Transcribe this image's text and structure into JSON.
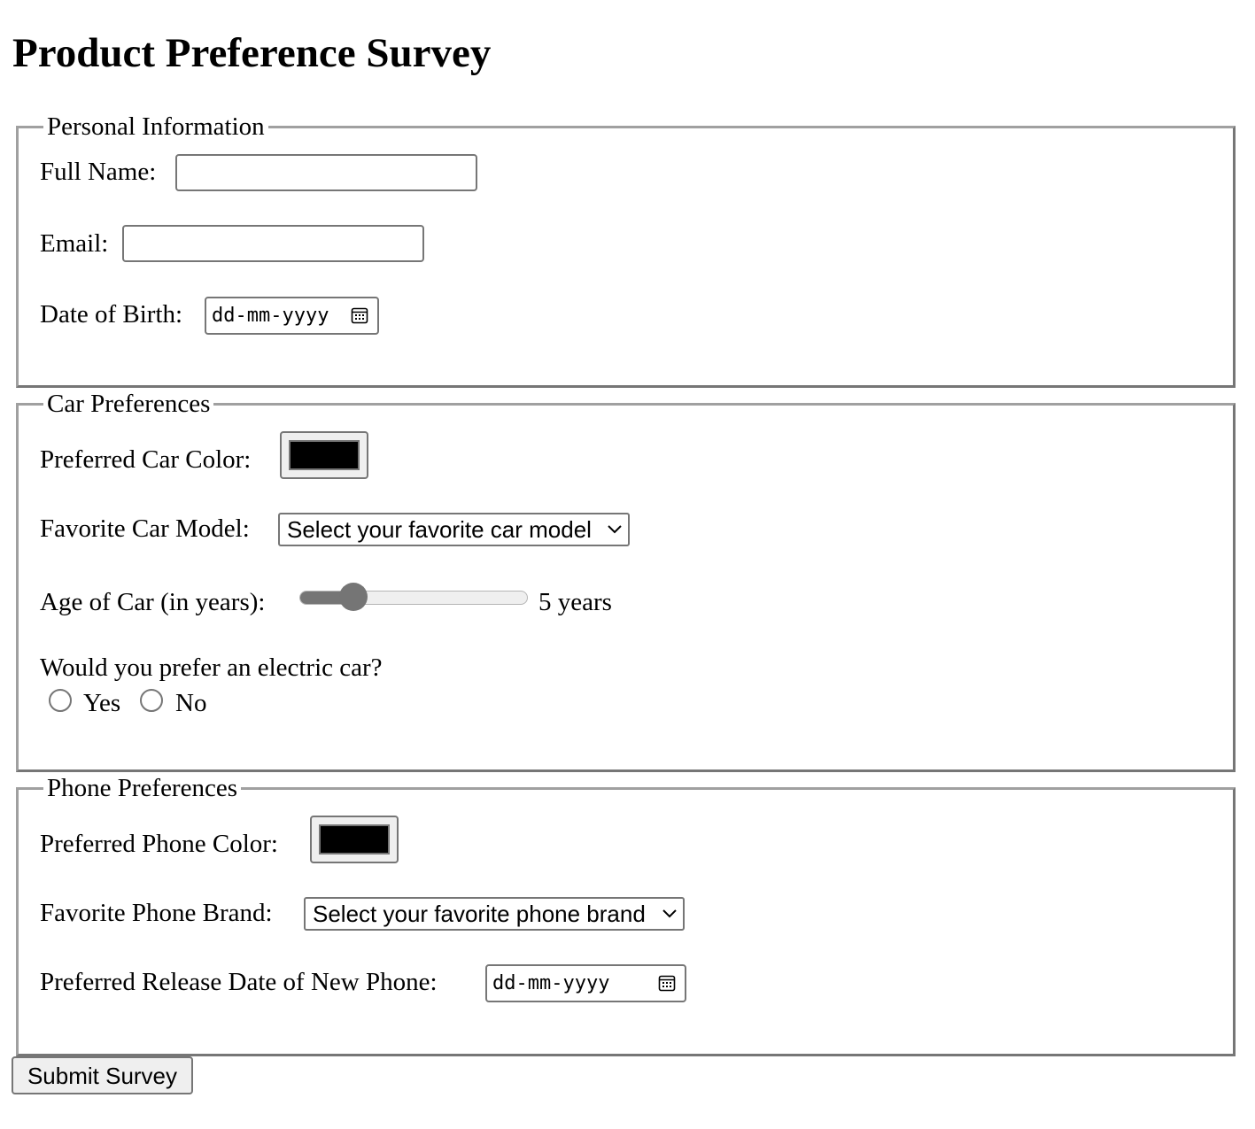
{
  "page": {
    "title": "Product Preference Survey"
  },
  "personal": {
    "legend": "Personal Information",
    "full_name_label": "Full Name:",
    "full_name_value": "",
    "email_label": "Email:",
    "email_value": "",
    "dob_label": "Date of Birth:",
    "dob_placeholder": "dd-mm-yyyy"
  },
  "car": {
    "legend": "Car Preferences",
    "color_label": "Preferred Car Color:",
    "color_value": "#000000",
    "model_label": "Favorite Car Model:",
    "model_selected": "Select your favorite car model",
    "age_label": "Age of Car (in years):",
    "age_value": 5,
    "age_min": 0,
    "age_max": 25,
    "age_display": "5 years",
    "electric_question": "Would you prefer an electric car?",
    "electric_options": [
      "Yes",
      "No"
    ]
  },
  "phone": {
    "legend": "Phone Preferences",
    "color_label": "Preferred Phone Color:",
    "color_value": "#000000",
    "brand_label": "Favorite Phone Brand:",
    "brand_selected": "Select your favorite phone brand",
    "release_label": "Preferred Release Date of New Phone:",
    "release_placeholder": "dd-mm-yyyy"
  },
  "submit": {
    "label": "Submit Survey"
  },
  "icons": {
    "calendar": "calendar-icon",
    "chevron": "chevron-down-icon"
  }
}
